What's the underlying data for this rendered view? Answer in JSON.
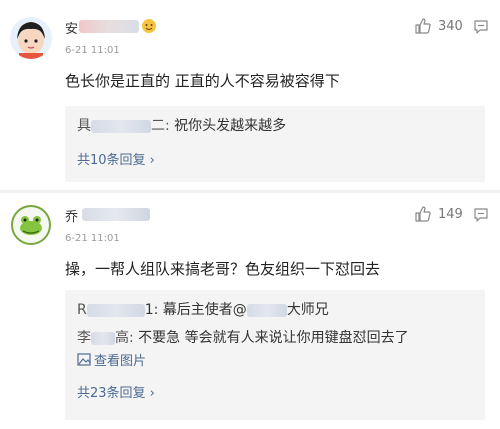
{
  "comments": [
    {
      "username": "安",
      "timestamp": "6-21 11:01",
      "likes": "340",
      "text": "色长你是正直的 正直的人不容易被容得下",
      "replies": [
        {
          "name": "具",
          "suffix": "二:",
          "text": "祝你头发越来越多"
        }
      ],
      "more_replies": "共10条回复 ›"
    },
    {
      "username": "乔",
      "timestamp": "6-21 11:01",
      "likes": "149",
      "text": "操，一帮人组队来搞老哥？色友组织一下怼回去",
      "replies": [
        {
          "name": "R",
          "mid": "1: 幕后主使者@",
          "after": "大师兄"
        },
        {
          "name": "李",
          "suffix": "高:",
          "text": "不要急 等会就有人来说让你用键盘怼回去了"
        }
      ],
      "image_link": "查看图片",
      "more_replies": "共23条回复 ›"
    }
  ],
  "icons": {
    "like": "thumbs-up-icon",
    "reply": "reply-icon",
    "image": "image-icon"
  },
  "colors": {
    "link": "#4d6a92",
    "subbox": "#f4f4f4",
    "meta": "#9a9a9a"
  }
}
